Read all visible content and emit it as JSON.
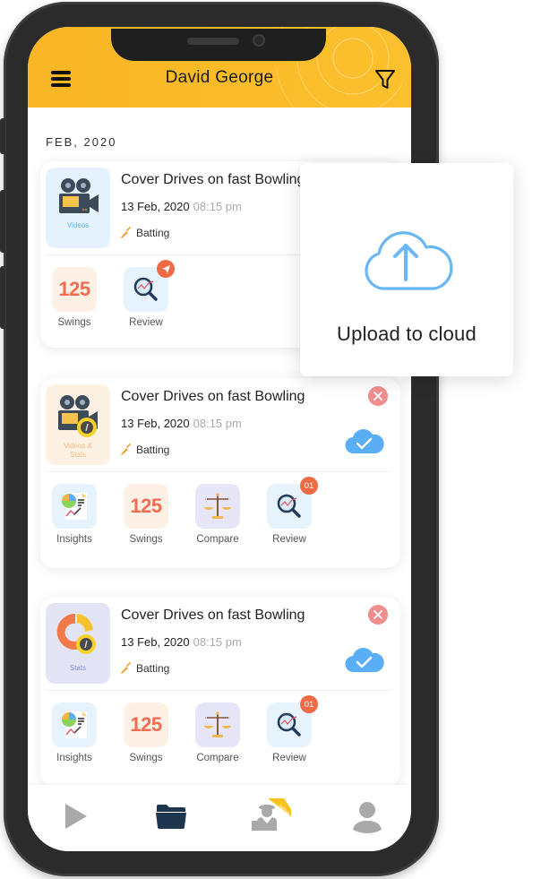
{
  "header": {
    "title": "David George",
    "menu_icon": "hamburger-menu-icon",
    "filter_icon": "filter-funnel-icon",
    "accent_color": "#fbbf2a"
  },
  "section": {
    "label": "FEB, 2020"
  },
  "sessions": [
    {
      "thumb_type": "Videos",
      "thumb_icon": "video-camera-icon",
      "title": "Cover Drives on fast Bowling",
      "date": "13 Feb, 2020",
      "time": "08:15 pm",
      "tag": "Batting",
      "tag_icon": "cricket-bat-icon",
      "actions": [
        {
          "label": "Swings",
          "value": "125",
          "icon": "swings-count"
        },
        {
          "label": "Review",
          "icon": "review-magnifier-icon",
          "badge_icon": "paper-plane-icon"
        }
      ]
    },
    {
      "thumb_type": "Videos & Stats",
      "thumb_icon": "video-camera-stats-icon",
      "title": "Cover Drives on fast Bowling",
      "date": "13 Feb, 2020",
      "time": "08:15 pm",
      "tag": "Batting",
      "tag_icon": "cricket-bat-icon",
      "status": "uploaded",
      "actions": [
        {
          "label": "Insights",
          "icon": "insights-report-icon"
        },
        {
          "label": "Swings",
          "value": "125",
          "icon": "swings-count"
        },
        {
          "label": "Compare",
          "icon": "balance-scale-icon"
        },
        {
          "label": "Review",
          "icon": "review-magnifier-icon",
          "badge": "01"
        }
      ]
    },
    {
      "thumb_type": "Stats",
      "thumb_icon": "donut-chart-icon",
      "title": "Cover Drives on fast Bowling",
      "date": "13 Feb, 2020",
      "time": "08:15 pm",
      "tag": "Batting",
      "tag_icon": "cricket-bat-icon",
      "status": "uploaded",
      "actions": [
        {
          "label": "Insights",
          "icon": "insights-report-icon"
        },
        {
          "label": "Swings",
          "value": "125",
          "icon": "swings-count"
        },
        {
          "label": "Compare",
          "icon": "balance-scale-icon"
        },
        {
          "label": "Review",
          "icon": "review-magnifier-icon",
          "badge": "01"
        }
      ]
    }
  ],
  "popup": {
    "label": "Upload to cloud",
    "icon": "cloud-upload-icon"
  },
  "bottom_nav": [
    {
      "name": "play",
      "icon": "play-icon",
      "active": false
    },
    {
      "name": "sessions",
      "icon": "folder-icon",
      "active": true
    },
    {
      "name": "coach",
      "icon": "coach-icon",
      "ribbon": "NEW",
      "active": false
    },
    {
      "name": "profile",
      "icon": "user-icon",
      "active": false
    }
  ]
}
